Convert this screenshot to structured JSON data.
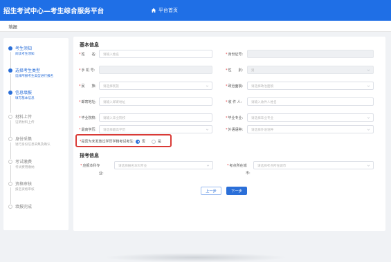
{
  "header": {
    "title": "招生考试中心—考生综合服务平台",
    "home_label": "平台首页"
  },
  "breadcrumb": {
    "label": "填报"
  },
  "steps": [
    {
      "title": "考生须知",
      "desc": "阅读考生须知",
      "state": "done"
    },
    {
      "title": "选择考生类型",
      "desc": "选择所报考生类型进行报名",
      "state": "done"
    },
    {
      "title": "信息填报",
      "desc": "填写基本信息",
      "state": "active"
    },
    {
      "title": "材料上传",
      "desc": "证明材料上传",
      "state": "pending"
    },
    {
      "title": "身份采集",
      "desc": "进行身份信息采集及确认",
      "state": "pending"
    },
    {
      "title": "考试缴费",
      "desc": "考试费用缴纳",
      "state": "pending"
    },
    {
      "title": "资格审核",
      "desc": "报名资格审核",
      "state": "pending"
    },
    {
      "title": "填报完成",
      "desc": "",
      "state": "pending"
    }
  ],
  "basic_info": {
    "section_title": "基本信息",
    "fields": {
      "name": {
        "label": "姓　　名:",
        "placeholder": "请输入姓名"
      },
      "id_number": {
        "label": "身份证号:",
        "placeholder": ""
      },
      "phone": {
        "label": "手 机 号:",
        "placeholder": ""
      },
      "gender": {
        "label": "性　　别:",
        "placeholder": "男"
      },
      "ethnicity": {
        "label": "民　　族:",
        "placeholder": "请选择民族"
      },
      "political_status": {
        "label": "政治面貌:",
        "placeholder": "请选择政治面貌"
      },
      "mailing_address": {
        "label": "邮寄地址:",
        "placeholder": "请输入邮寄地址"
      },
      "recipient": {
        "label": "收 件 人:",
        "placeholder": "请输入收件人姓名"
      },
      "graduate_school": {
        "label": "毕业院校:",
        "placeholder": "请输入毕业院校"
      },
      "graduate_major": {
        "label": "毕业专业:",
        "placeholder": "请选择毕业专业"
      },
      "highest_degree": {
        "label": "最高学历:",
        "placeholder": "请选择最高学历"
      },
      "foreign_language": {
        "label": "外语语种:",
        "placeholder": "请选择外语语种"
      }
    },
    "fresh_grad_question": "是否为未发放过学历学籍考试考生:",
    "fresh_grad_options": [
      {
        "label": "否",
        "checked": true
      },
      {
        "label": "是",
        "checked": false
      }
    ]
  },
  "exam_info": {
    "section_title": "报考信息",
    "subject_label_line1": "应报本科专",
    "subject_label_line2": "业:",
    "subject_placeholder": "请选择报名本科专业",
    "location_label_line1": "考点所在城",
    "location_label_line2": "市:",
    "location_placeholder": "请选择考点所在城市"
  },
  "buttons": {
    "prev": "上一步",
    "next": "下一步"
  },
  "colors": {
    "primary": "#1f6fe6",
    "highlight_border": "#d93a36"
  }
}
